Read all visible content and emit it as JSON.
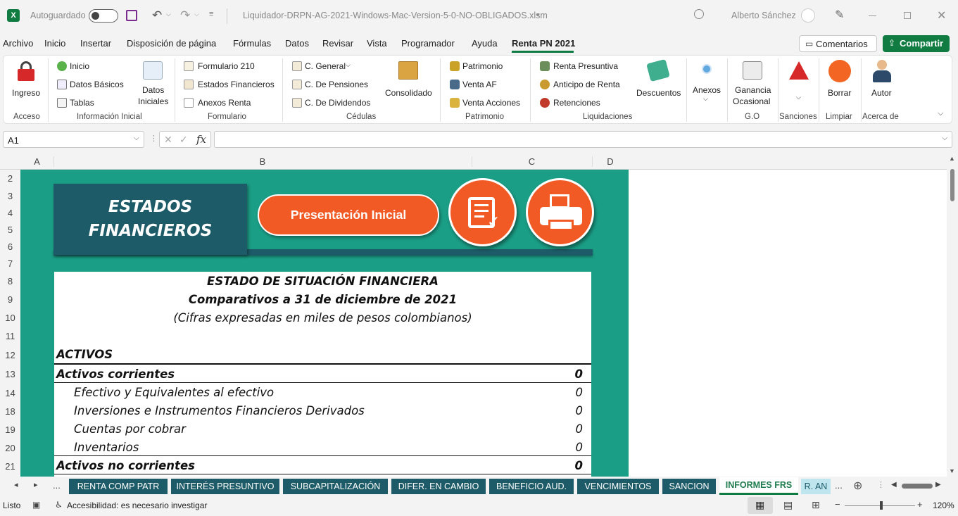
{
  "titlebar": {
    "autosave_label": "Autoguardado",
    "filename": "Liquidador-DRPN-AG-2021-Windows-Mac-Version-5-0-NO-OBLIGADOS.xlsm",
    "user": "Alberto Sánchez"
  },
  "menu": [
    "Archivo",
    "Inicio",
    "Insertar",
    "Disposición de página",
    "Fórmulas",
    "Datos",
    "Revisar",
    "Vista",
    "Programador",
    "Ayuda",
    "Renta PN 2021"
  ],
  "menu_right": {
    "comments": "Comentarios",
    "share": "Compartir"
  },
  "ribbon": {
    "ingreso": "Ingreso",
    "inicio": "Inicio",
    "datos_basicos": "Datos Básicos",
    "tablas": "Tablas",
    "datos_iniciales_1": "Datos",
    "datos_iniciales_2": "Iniciales",
    "formulario_210": "Formulario 210",
    "estados_financieros": "Estados Financieros",
    "anexos_renta": "Anexos Renta",
    "c_general": "C. General",
    "c_pensiones": "C. De Pensiones",
    "c_dividendos": "C. De Dividendos",
    "consolidado": "Consolidado",
    "patrimonio": "Patrimonio",
    "venta_af": "Venta AF",
    "venta_acciones": "Venta Acciones",
    "renta_presuntiva": "Renta Presuntiva",
    "anticipo_renta": "Anticipo de Renta",
    "retenciones": "Retenciones",
    "descuentos": "Descuentos",
    "anexos": "Anexos",
    "ganancia_1": "Ganancia",
    "ganancia_2": "Ocasional",
    "borrar": "Borrar",
    "autor": "Autor",
    "groups": {
      "acceso": "Acceso",
      "info_inicial": "Información Inicial",
      "formulario": "Formulario",
      "cedulas": "Cédulas",
      "patrimonio": "Patrimonio",
      "liquidaciones": "Liquidaciones",
      "go": "G.O",
      "sanciones": "Sanciones",
      "limpiar": "Limpiar",
      "acerca": "Acerca de"
    }
  },
  "formula_bar": {
    "name_box": "A1",
    "fx": "fx"
  },
  "columns": [
    "A",
    "B",
    "C",
    "D"
  ],
  "rows": [
    "2",
    "3",
    "4",
    "5",
    "6",
    "7",
    "8",
    "9",
    "10",
    "11",
    "12",
    "13",
    "14",
    "18",
    "19",
    "20",
    "21"
  ],
  "sheet": {
    "banner_line1": "ESTADOS",
    "banner_line2": "FINANCIEROS",
    "btn_presentacion": "Presentación Inicial",
    "report_title": "ESTADO DE SITUACIÓN FINANCIERA",
    "report_subtitle": "Comparativos a 31 de diciembre de 2021",
    "report_note": "(Cifras expresadas en miles de pesos colombianos)",
    "activos": "ACTIVOS",
    "lines": [
      {
        "label": "Activos corrientes",
        "value": "0",
        "bold": true
      },
      {
        "label": "Efectivo y Equivalentes al efectivo",
        "value": "0",
        "bold": false
      },
      {
        "label": "Inversiones e Instrumentos Financieros Derivados",
        "value": "0",
        "bold": false
      },
      {
        "label": "Cuentas por cobrar",
        "value": "0",
        "bold": false
      },
      {
        "label": "Inventarios",
        "value": "0",
        "bold": false
      },
      {
        "label": "Activos no corrientes",
        "value": "0",
        "bold": true
      }
    ]
  },
  "tabs": [
    "RENTA COMP PATR",
    "INTERÉS PRESUNTIVO",
    "SUBCAPITALIZACIÓN",
    "DIFER. EN CAMBIO",
    "BENEFICIO AUD.",
    "VENCIMIENTOS",
    "SANCION",
    "INFORMES FRS",
    "R. AN"
  ],
  "active_tab": "INFORMES FRS",
  "status": {
    "ready": "Listo",
    "accessibility": "Accesibilidad: es necesario investigar",
    "zoom": "120%"
  }
}
